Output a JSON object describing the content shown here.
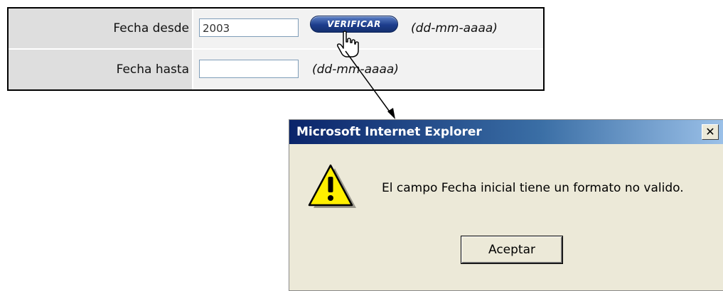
{
  "form": {
    "from": {
      "label": "Fecha desde",
      "value": "2003",
      "hint": "(dd-mm-aaaa)",
      "verify_label": "VERIFICAR"
    },
    "to": {
      "label": "Fecha hasta",
      "value": "",
      "hint": "(dd-mm-aaaa)"
    }
  },
  "dialog": {
    "title": "Microsoft Internet Explorer",
    "close_glyph": "✕",
    "message": "El campo Fecha inicial tiene un formato no valido.",
    "ok_label": "Aceptar",
    "icon": "warning-icon"
  },
  "colors": {
    "label_bg": "#dedede",
    "field_bg": "#f2f2f2",
    "button_blue": "#1d3d8c",
    "titlebar": "#0a246a",
    "dialog_bg": "#ece9d8"
  }
}
